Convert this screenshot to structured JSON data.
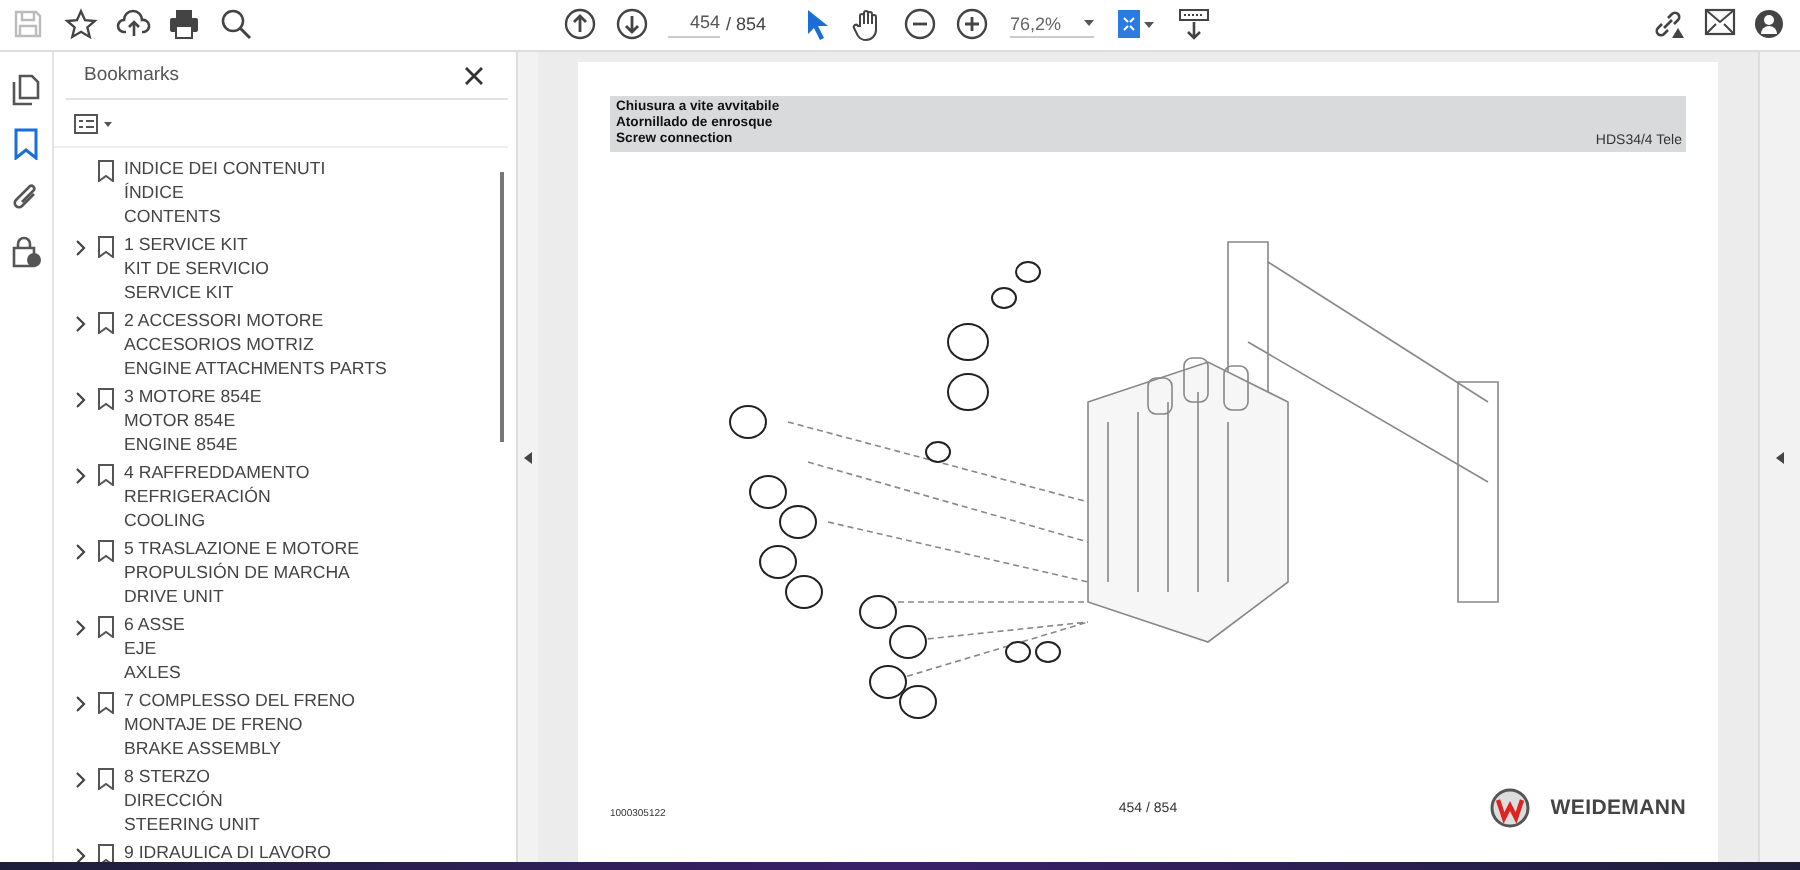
{
  "toolbar": {
    "page_field": {
      "value": "454"
    },
    "page_total": "/ 854",
    "zoom": {
      "value": "76,2%"
    }
  },
  "rail": [
    {
      "kind": "pages",
      "selected": false
    },
    {
      "kind": "bookmarks",
      "selected": true
    },
    {
      "kind": "attachments",
      "selected": false
    },
    {
      "kind": "security",
      "selected": false
    }
  ],
  "bookmarks": {
    "title": "Bookmarks",
    "items": [
      {
        "lines": [
          "INDICE DEI CONTENUTI",
          "ÍNDICE",
          "CONTENTS"
        ],
        "expandable": false
      },
      {
        "lines": [
          "1 SERVICE KIT",
          "KIT DE SERVICIO",
          "SERVICE KIT"
        ],
        "expandable": true
      },
      {
        "lines": [
          "2 ACCESSORI MOTORE",
          "ACCESORIOS MOTRIZ",
          "ENGINE ATTACHMENTS PARTS"
        ],
        "expandable": true
      },
      {
        "lines": [
          "3 MOTORE 854E",
          "MOTOR 854E",
          "ENGINE 854E"
        ],
        "expandable": true
      },
      {
        "lines": [
          "4 RAFFREDDAMENTO",
          "REFRIGERACIÓN",
          "COOLING"
        ],
        "expandable": true
      },
      {
        "lines": [
          "5 TRASLAZIONE E MOTORE",
          "PROPULSIÓN DE MARCHA",
          "DRIVE UNIT"
        ],
        "expandable": true
      },
      {
        "lines": [
          "6 ASSE",
          "EJE",
          "AXLES"
        ],
        "expandable": true
      },
      {
        "lines": [
          "7 COMPLESSO DEL FRENO",
          "MONTAJE DE FRENO",
          "BRAKE ASSEMBLY"
        ],
        "expandable": true
      },
      {
        "lines": [
          "8 STERZO",
          "DIRECCIÓN",
          "STEERING UNIT"
        ],
        "expandable": true
      },
      {
        "lines": [
          "9 IDRAULICA DI LAVORO"
        ],
        "expandable": true
      }
    ]
  },
  "page": {
    "header": [
      "Chiusura a vite avvitabile",
      "Atornillado de enrosque",
      "Screw connection"
    ],
    "model": "HDS34/4 Tele",
    "code": "1000305122",
    "page_number": "454 / 854",
    "brand": "WEIDEMANN"
  }
}
